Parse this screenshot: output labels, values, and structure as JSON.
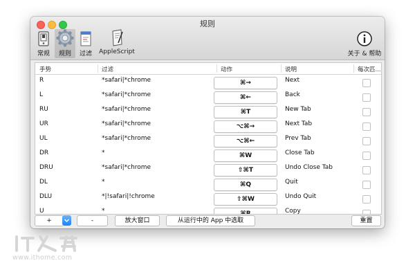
{
  "window": {
    "title": "规则"
  },
  "toolbar": {
    "items": [
      {
        "label": "常规",
        "icon": "switch-icon"
      },
      {
        "label": "规则",
        "icon": "gear-icon",
        "active": true
      },
      {
        "label": "过滤",
        "icon": "filter-doc-icon"
      },
      {
        "label": "AppleScript",
        "icon": "script-icon"
      },
      {
        "label": "关于 & 帮助",
        "icon": "info-icon"
      }
    ]
  },
  "table": {
    "columns": [
      "手势",
      "过滤",
      "动作",
      "说明",
      "每次匹..."
    ],
    "rows": [
      {
        "gesture": "R",
        "filter": "*safari|*chrome",
        "action": "⌘→",
        "desc": "Next",
        "checked": false
      },
      {
        "gesture": "L",
        "filter": "*safari|*chrome",
        "action": "⌘←",
        "desc": "Back",
        "checked": false
      },
      {
        "gesture": "RU",
        "filter": "*safari|*chrome",
        "action": "⌘T",
        "desc": "New Tab",
        "checked": false
      },
      {
        "gesture": "UR",
        "filter": "*safari|*chrome",
        "action": "⌥⌘→",
        "desc": "Next Tab",
        "checked": false
      },
      {
        "gesture": "UL",
        "filter": "*safari|*chrome",
        "action": "⌥⌘←",
        "desc": "Prev Tab",
        "checked": false
      },
      {
        "gesture": "DR",
        "filter": "*",
        "action": "⌘W",
        "desc": "Close Tab",
        "checked": false
      },
      {
        "gesture": "DRU",
        "filter": "*safari|*chrome",
        "action": "⇧⌘T",
        "desc": "Undo Close Tab",
        "checked": false
      },
      {
        "gesture": "DL",
        "filter": "*",
        "action": "⌘Q",
        "desc": "Quit",
        "checked": false
      },
      {
        "gesture": "DLU",
        "filter": "*|!safari|!chrome",
        "action": "⇧⌘W",
        "desc": "Undo Quit",
        "checked": false
      },
      {
        "gesture": "U",
        "filter": "*",
        "action": "⌘R",
        "desc": "Copy",
        "checked": false
      }
    ]
  },
  "bottom": {
    "add_label": "+",
    "remove_label": "-",
    "enlarge_label": "放大窗口",
    "pick_app_label": "从运行中的 App 中选取",
    "reset_label": "重置"
  },
  "watermark": {
    "logo": "IT之家",
    "url": "www.ithome.com"
  },
  "colors": {
    "accent": "#1a82fb",
    "close": "#fc605c",
    "minimize": "#fdbc40",
    "maximize": "#34c84a"
  }
}
